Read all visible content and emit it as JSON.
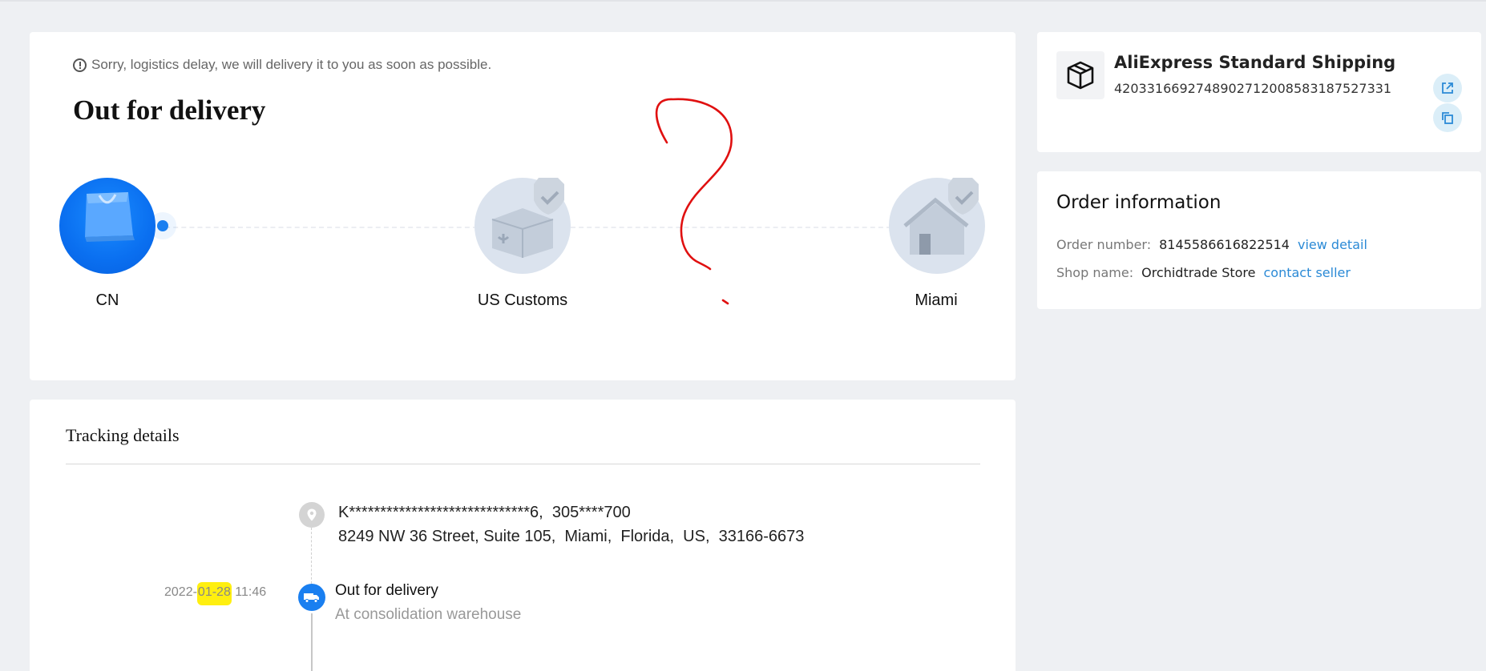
{
  "status_card": {
    "notice": "Sorry, logistics delay, we will delivery it to you as soon as possible.",
    "title": "Out for delivery",
    "nodes": [
      {
        "label": "CN",
        "state": "active",
        "icon": "shopping-bag-icon"
      },
      {
        "label": "US Customs",
        "state": "inactive",
        "icon": "customs-package-icon"
      },
      {
        "label": "Miami",
        "state": "inactive",
        "icon": "house-icon"
      }
    ]
  },
  "shipping": {
    "carrier": "AliExpress Standard Shipping",
    "tracking_number": "420331669274890271200858318752733",
    "tracking_number_display": "4203316692748902712008583187527331",
    "icons": {
      "package": "package-box-icon",
      "open": "external-link-icon",
      "copy": "copy-icon"
    }
  },
  "order": {
    "title": "Order information",
    "number_label": "Order number:",
    "number_value": "8145586616822514",
    "view_detail": "view detail",
    "shop_label": "Shop name:",
    "shop_value": "Orchidtrade Store",
    "contact_seller": "contact seller"
  },
  "tracking": {
    "title": "Tracking details",
    "address_line1": "K*****************************6,  305****700",
    "address_line2": "8249 NW 36 Street, Suite 105,  Miami,  Florida,  US,  33166-6673",
    "events": [
      {
        "time_prefix": "2022-",
        "time_highlight": "01-28",
        "time_suffix": " 11:46",
        "status": "Out for delivery",
        "description": "At consolidation warehouse"
      }
    ]
  },
  "colors": {
    "accent": "#1a7ff0",
    "link": "#2b8ad6",
    "background": "#eef0f3",
    "annotation_red": "#e01010",
    "highlight_yellow": "#ffef10"
  }
}
